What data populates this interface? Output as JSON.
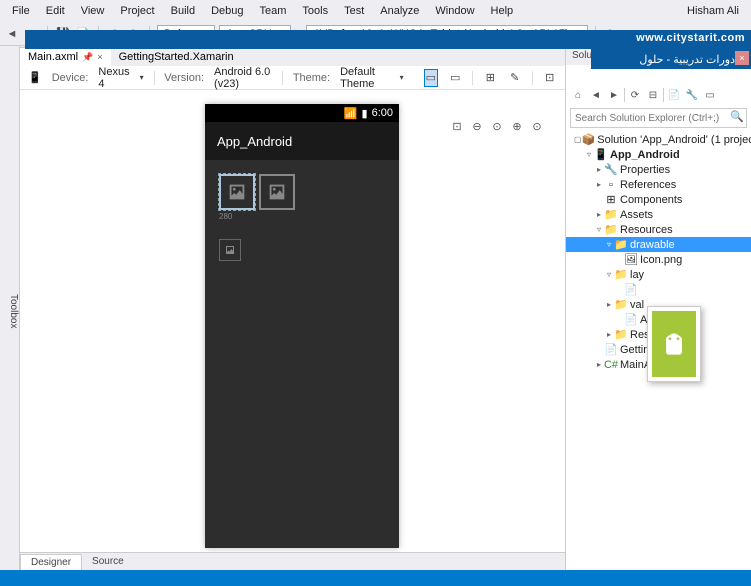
{
  "menu": {
    "items": [
      "File",
      "Edit",
      "View",
      "Project",
      "Build",
      "Debug",
      "Team",
      "Tools",
      "Test",
      "Analyze",
      "Window",
      "Help"
    ],
    "user": "Hisham Ali"
  },
  "toolbar": {
    "config": "Debug",
    "platform": "Any CPU",
    "target": "AVD_for_10_1_WXGA_Tablet (Android 4.2 - API 17)"
  },
  "tabs": {
    "items": [
      {
        "label": "Main.axml",
        "active": true,
        "pinned": true
      },
      {
        "label": "GettingStarted.Xamarin",
        "active": false,
        "pinned": false
      }
    ]
  },
  "designer": {
    "device_label": "Device:",
    "device_value": "Nexus 4",
    "version_label": "Version:",
    "version_value": "Android 6.0 (v23)",
    "theme_label": "Theme:",
    "theme_value": "Default Theme"
  },
  "phone": {
    "time": "6:00",
    "app_title": "App_Android",
    "sel_label": "280"
  },
  "bottom_tabs": {
    "designer": "Designer",
    "source": "Source"
  },
  "overlay": {
    "url": "www.citystarit.com",
    "arabic": "دورات تدريبية - حلول"
  },
  "se": {
    "header": "Solution Explorer",
    "search_placeholder": "Search Solution Explorer (Ctrl+;)",
    "tree": {
      "solution": "Solution 'App_Android' (1 project)",
      "project": "App_Android",
      "properties": "Properties",
      "references": "References",
      "components": "Components",
      "assets": "Assets",
      "resources": "Resources",
      "drawable": "drawable",
      "icon": "Icon.png",
      "layout": "lay",
      "values": "val",
      "about": "Ab",
      "res2": "Res",
      "getting": "Gettin",
      "main": "MainActivity.cs"
    }
  },
  "toolbox_label": "Toolbox"
}
